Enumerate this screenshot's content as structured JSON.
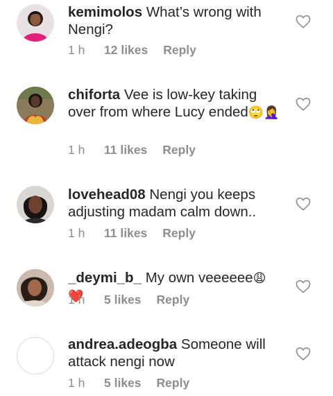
{
  "comments": [
    {
      "username": "kemimolos",
      "text": "What’s wrong with Nengi?",
      "time": "1 h",
      "likes": "12 likes",
      "reply": "Reply",
      "avatar_icon": "woman-avatar-icon",
      "liked": false
    },
    {
      "username": "chiforta",
      "text": "Vee is low-key taking over from where Lucy ended",
      "emoji": "🙄🤦‍♀️",
      "time": "1 h",
      "likes": "11 likes",
      "reply": "Reply",
      "avatar_icon": "woman-portrait-avatar-icon",
      "liked": false
    },
    {
      "username": "lovehead08",
      "text": "Nengi you keeps adjusting madam calm down..",
      "time": "1 h",
      "likes": "11 likes",
      "reply": "Reply",
      "avatar_icon": "woman-closeup-avatar-icon",
      "liked": false
    },
    {
      "username": "_deymi_b_",
      "text": "My own veeeeee",
      "emoji": "😩❤️",
      "time": "1 h",
      "likes": "5 likes",
      "reply": "Reply",
      "avatar_icon": "woman-selfie-avatar-icon",
      "liked": false
    },
    {
      "username": "andrea.adeogba",
      "text": "Someone will attack nengi now",
      "time": "1 h",
      "likes": "5 likes",
      "reply": "Reply",
      "avatar_icon": "empty-avatar-icon",
      "liked": false
    }
  ],
  "colors": {
    "text": "#262626",
    "meta": "#8e8e8e",
    "heart_outline": "#8e8e8e"
  }
}
